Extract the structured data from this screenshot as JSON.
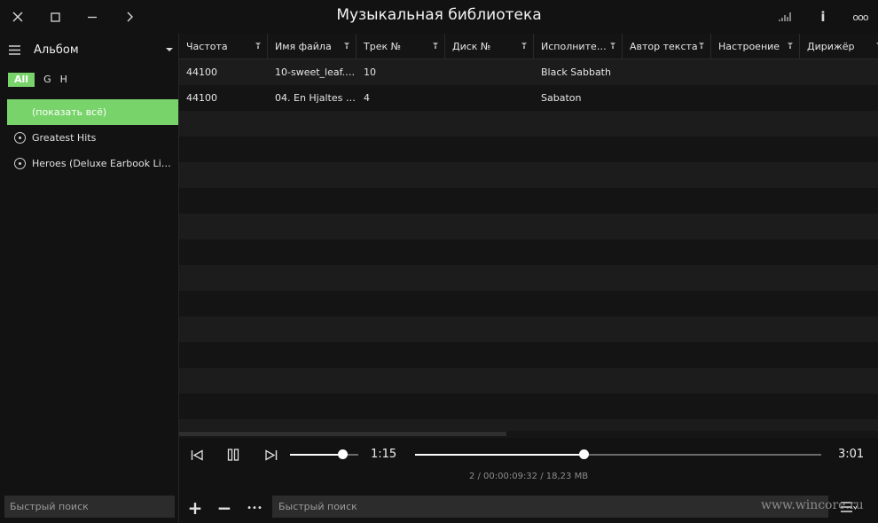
{
  "app": {
    "title": "Музыкальная библиотека"
  },
  "titlebar": {
    "icons": [
      "close-icon",
      "maximize-icon",
      "minimize-icon",
      "forward-icon",
      "equalizer-icon",
      "info-icon",
      "more-icon"
    ],
    "info_glyph": "i",
    "more_glyph": "ooo"
  },
  "sidebar": {
    "title": "Альбом",
    "letters": [
      "All",
      "G",
      "H"
    ],
    "albums": [
      {
        "label": "(показать всё)",
        "selected": true
      },
      {
        "label": "Greatest Hits",
        "selected": false
      },
      {
        "label": "Heroes (Deluxe Earbook Limited Edition)",
        "selected": false
      }
    ],
    "search_placeholder": "Быстрый поиск"
  },
  "table": {
    "columns": [
      "Частота",
      "Имя файла",
      "Трек №",
      "Диск №",
      "Исполнитель",
      "Автор текста",
      "Настроение",
      "Дирижёр"
    ],
    "column_display": [
      "Частота",
      "Имя файла",
      "Трек №",
      "Диск №",
      "Исполните…",
      "Автор текста",
      "Настроение",
      "Дирижёр"
    ],
    "rows": [
      [
        "44100",
        "10-sweet_leaf.…",
        "10",
        "",
        "Black Sabbath",
        "",
        "",
        ""
      ],
      [
        "44100",
        "04. En Hjaltes …",
        "4",
        "",
        "Sabaton",
        "",
        "",
        ""
      ]
    ],
    "empty_rows": 14
  },
  "player": {
    "current_time": "1:15",
    "total_time": "3:01",
    "seek_fraction": 0.41,
    "volume_fraction": 0.77,
    "status": "2 / 00:00:09:32 / 18,23 MB"
  },
  "bottombar": {
    "search_placeholder": "Быстрый поиск",
    "add_glyph": "+",
    "remove_glyph": "−",
    "more_glyph": "•••"
  },
  "watermark": "www.wincore.ru",
  "colors": {
    "accent": "#77d36a",
    "background": "#121212",
    "row_alt": "#1c1c1c"
  }
}
